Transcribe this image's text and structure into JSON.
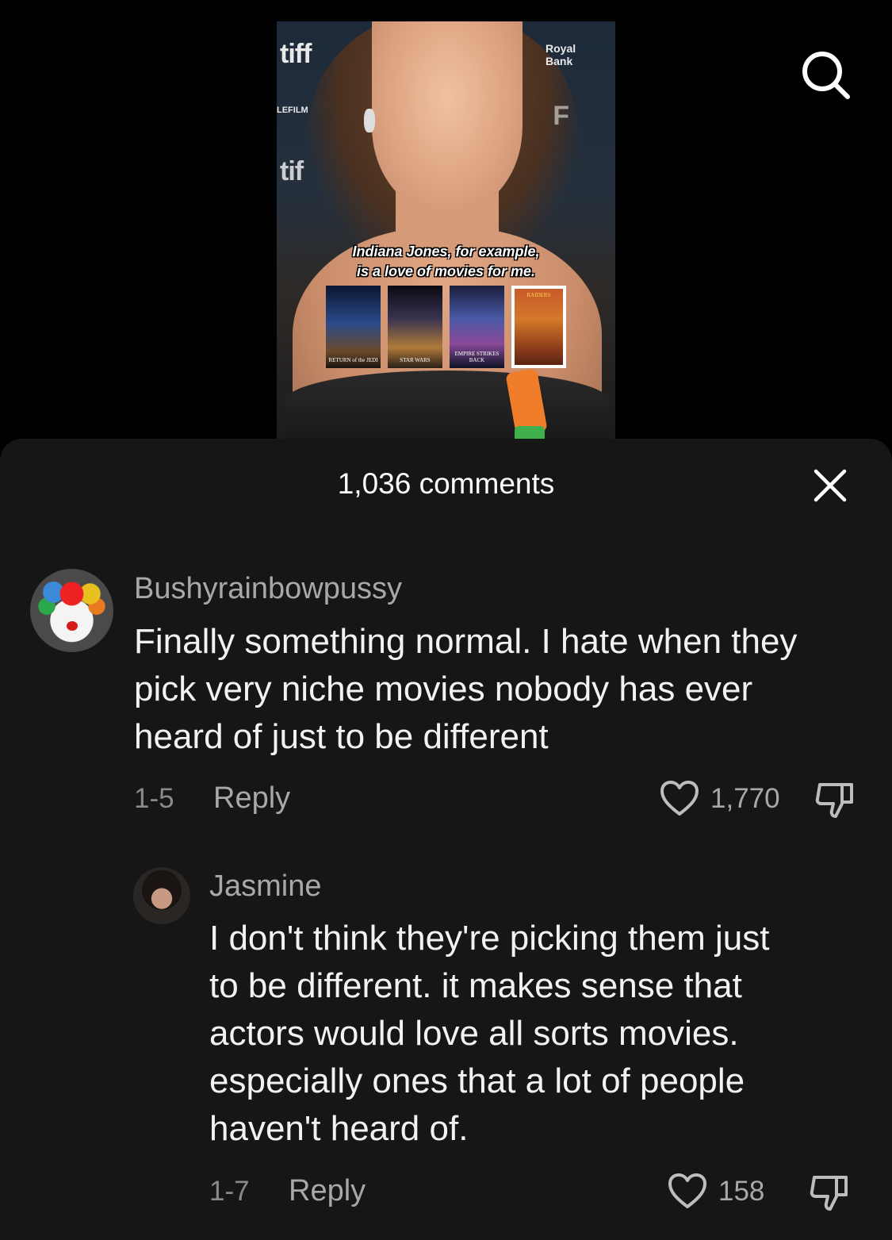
{
  "video": {
    "backdrop": {
      "logo_top": "tiff",
      "logo_left_small": "LEFILM",
      "logo_mid": "tif",
      "sponsor": "Royal Bank",
      "letter_right": "F"
    },
    "caption_line1": "Indiana Jones, for example,",
    "caption_line2": "is a love of movies for me.",
    "posters": [
      {
        "title": "RETURN of the JEDI"
      },
      {
        "title": "STAR WARS"
      },
      {
        "title": "EMPIRE STRIKES BACK"
      },
      {
        "title": "RAIDERS"
      }
    ]
  },
  "search": {
    "icon": "search-icon"
  },
  "comments_sheet": {
    "title": "1,036 comments",
    "close_icon": "close-icon",
    "comments": [
      {
        "username": "Bushyrainbowpussy",
        "text_lines": [
          "Finally something normal. I hate when they",
          "pick very niche movies nobody has ever",
          "heard of just to be different"
        ],
        "date": "1-5",
        "reply_label": "Reply",
        "likes": "1,770"
      },
      {
        "username": "Jasmine",
        "text_lines": [
          "I don't think they're picking them just",
          "to be different. it makes sense that",
          "actors would love all sorts movies.",
          "especially ones that a lot of people",
          "haven't heard of."
        ],
        "date": "1-7",
        "reply_label": "Reply",
        "likes": "158"
      }
    ]
  },
  "colors": {
    "sheet_bg": "#161616",
    "page_bg": "#000000",
    "text_primary": "#f2f2f2",
    "text_secondary": "#a8a8a8"
  }
}
